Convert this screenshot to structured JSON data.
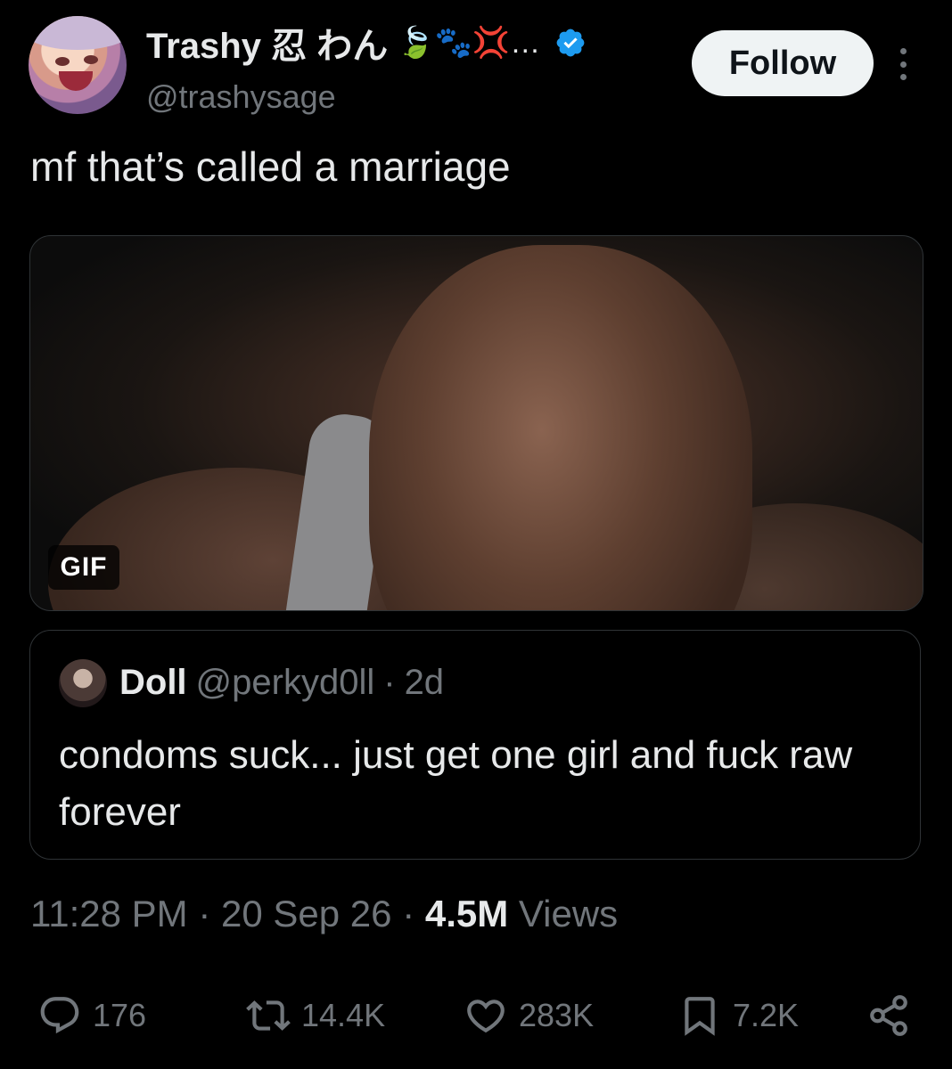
{
  "author": {
    "display_name": "Trashy 忍 わん",
    "emojis": "🍃🐾💢…",
    "handle": "@trashysage",
    "verified": true
  },
  "follow_label": "Follow",
  "tweet_text": "mf that’s called a marriage",
  "media": {
    "badge": "GIF"
  },
  "quoted": {
    "name": "Doll",
    "handle": "@perkyd0ll",
    "separator": "·",
    "time": "2d",
    "text": "condoms suck... just get one girl and fuck raw forever"
  },
  "meta": {
    "time": "11:28 PM",
    "sep1": "·",
    "date": "20 Sep 26",
    "sep2": "·",
    "views_count": "4.5M",
    "views_label": "Views"
  },
  "actions": {
    "replies": "176",
    "reposts": "14.4K",
    "likes": "283K",
    "bookmarks": "7.2K"
  },
  "colors": {
    "background": "#000000",
    "text": "#e7e9ea",
    "secondary": "#71767b",
    "verified": "#1d9bf0",
    "border": "#2f3336"
  },
  "icons": [
    "verified-badge-icon",
    "more-icon",
    "reply-icon",
    "repost-icon",
    "like-icon",
    "bookmark-icon",
    "share-icon"
  ]
}
